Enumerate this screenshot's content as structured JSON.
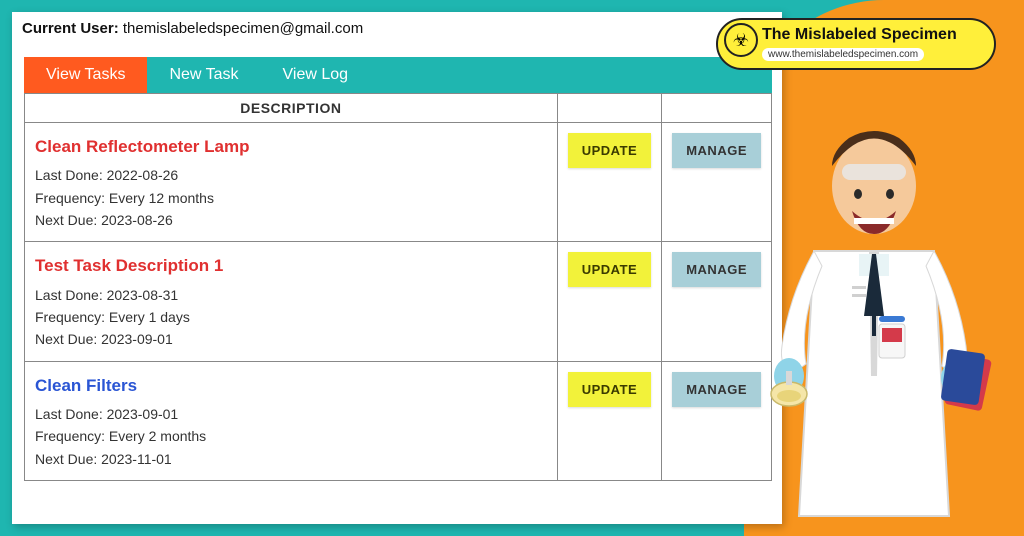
{
  "header": {
    "current_user_label": "Current User:",
    "current_user_email": "themislabeledspecimen@gmail.com"
  },
  "tabs": [
    {
      "label": "View Tasks",
      "active": true
    },
    {
      "label": "New Task",
      "active": false
    },
    {
      "label": "View Log",
      "active": false
    }
  ],
  "table": {
    "header_description": "DESCRIPTION",
    "update_label": "UPDATE",
    "manage_label": "MANAGE",
    "rows": [
      {
        "title": "Clean Reflectometer Lamp",
        "title_class": "red",
        "last_done": "Last Done: 2022-08-26",
        "frequency": "Frequency: Every 12 months",
        "next_due": "Next Due: 2023-08-26"
      },
      {
        "title": "Test Task Description 1",
        "title_class": "red",
        "last_done": "Last Done: 2023-08-31",
        "frequency": "Frequency: Every 1 days",
        "next_due": "Next Due: 2023-09-01"
      },
      {
        "title": "Clean Filters",
        "title_class": "blue",
        "last_done": "Last Done: 2023-09-01",
        "frequency": "Frequency: Every 2 months",
        "next_due": "Next Due: 2023-11-01"
      }
    ]
  },
  "branding": {
    "title": "The Mislabeled Specimen",
    "url": "www.themislabeledspecimen.com"
  }
}
